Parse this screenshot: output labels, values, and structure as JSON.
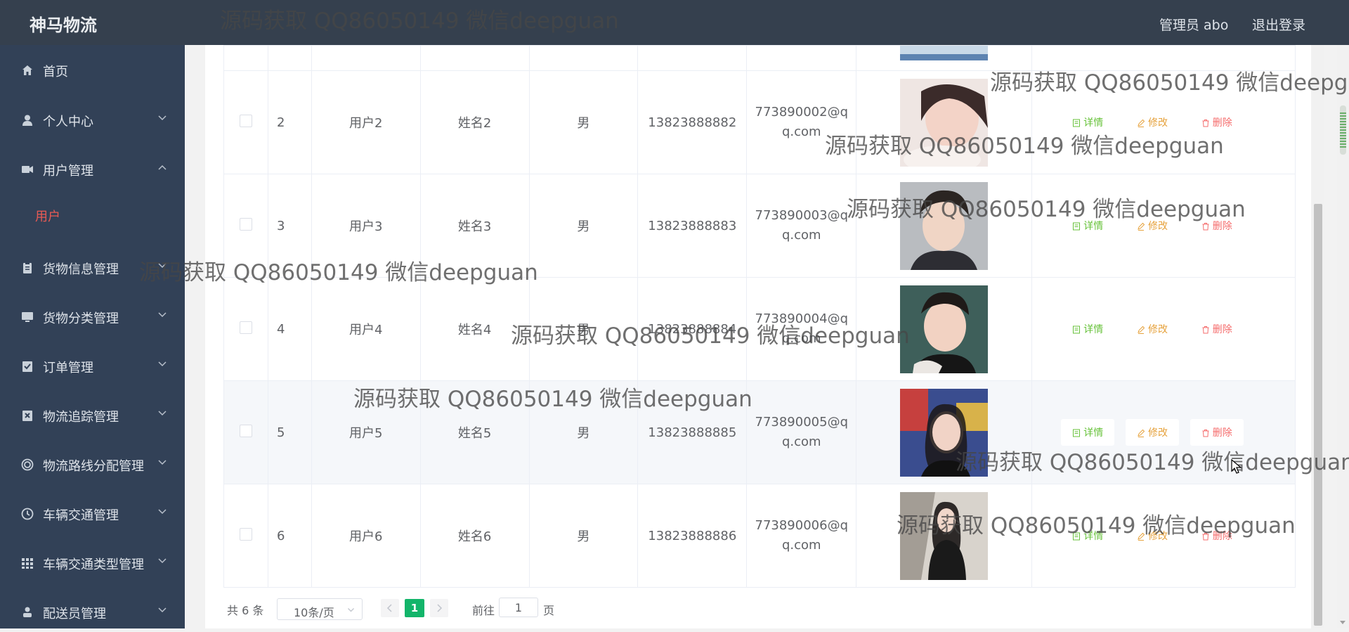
{
  "header": {
    "brand": "神马物流",
    "user_label": "管理员 abo",
    "logout_label": "退出登录"
  },
  "sidebar": {
    "items": [
      {
        "label": "首页",
        "icon": "home-icon",
        "has_arrow": false
      },
      {
        "label": "个人中心",
        "icon": "user-icon",
        "has_arrow": true,
        "arrow": "down"
      },
      {
        "label": "用户管理",
        "icon": "video-camera-icon",
        "has_arrow": true,
        "arrow": "up"
      },
      {
        "label": "货物信息管理",
        "icon": "clipboard-icon",
        "has_arrow": true,
        "arrow": "down"
      },
      {
        "label": "货物分类管理",
        "icon": "monitor-icon",
        "has_arrow": true,
        "arrow": "down"
      },
      {
        "label": "订单管理",
        "icon": "checklist-icon",
        "has_arrow": true,
        "arrow": "down"
      },
      {
        "label": "物流追踪管理",
        "icon": "close-box-icon",
        "has_arrow": true,
        "arrow": "down"
      },
      {
        "label": "物流路线分配管理",
        "icon": "target-icon",
        "has_arrow": true,
        "arrow": "down"
      },
      {
        "label": "车辆交通管理",
        "icon": "clock-icon",
        "has_arrow": true,
        "arrow": "down"
      },
      {
        "label": "车辆交通类型管理",
        "icon": "grid-icon",
        "has_arrow": true,
        "arrow": "down"
      },
      {
        "label": "配送员管理",
        "icon": "person-icon",
        "has_arrow": true,
        "arrow": "down"
      }
    ],
    "active_sub": "用户",
    "accent_color": "#e85a54"
  },
  "table": {
    "rows": [
      {
        "index": "2",
        "account": "用户2",
        "name": "姓名2",
        "gender": "男",
        "phone": "13823888882",
        "email_line1": "773890002@q",
        "email_line2": "q.com"
      },
      {
        "index": "3",
        "account": "用户3",
        "name": "姓名3",
        "gender": "男",
        "phone": "13823888883",
        "email_line1": "773890003@q",
        "email_line2": "q.com"
      },
      {
        "index": "4",
        "account": "用户4",
        "name": "姓名4",
        "gender": "男",
        "phone": "13823888884",
        "email_line1": "773890004@q",
        "email_line2": "q.com"
      },
      {
        "index": "5",
        "account": "用户5",
        "name": "姓名5",
        "gender": "男",
        "phone": "13823888885",
        "email_line1": "773890005@q",
        "email_line2": "q.com"
      },
      {
        "index": "6",
        "account": "用户6",
        "name": "姓名6",
        "gender": "男",
        "phone": "13823888886",
        "email_line1": "773890006@q",
        "email_line2": "q.com"
      }
    ],
    "actions": {
      "detail": "详情",
      "edit": "修改",
      "delete": "删除"
    },
    "colors": {
      "detail": "#67c23a",
      "edit": "#e6a23c",
      "delete": "#f56c6c"
    }
  },
  "pagination": {
    "total": "共 6 条",
    "page_size": "10条/页",
    "current_page": "1",
    "goto_label": "前往",
    "goto_value": "1",
    "goto_suffix": "页",
    "accent_color": "#13b56a"
  },
  "watermark": {
    "text": "源码获取 QQ86050149 微信deepguan",
    "truncated_text": "源码获取 QQ86050149 微信deepgua"
  }
}
